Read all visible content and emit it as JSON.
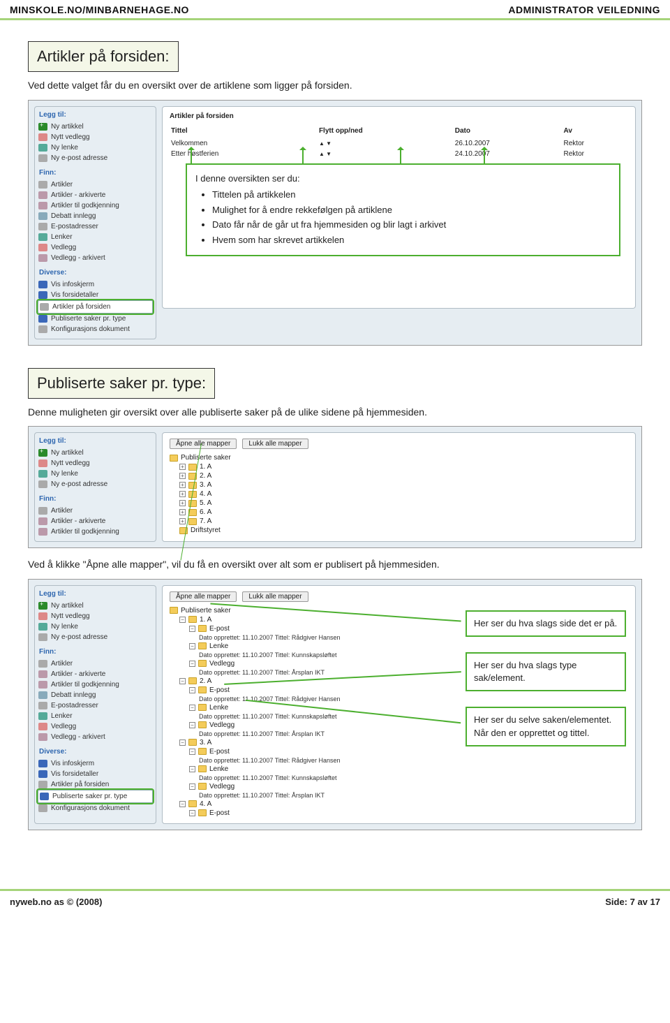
{
  "header": {
    "left": "MINSKOLE.NO/MINBARNEHAGE.NO",
    "right": "ADMINISTRATOR VEILEDNING"
  },
  "sec1": {
    "title": "Artikler på forsiden:",
    "intro": "Ved dette valget får du en oversikt over de artiklene som ligger på forsiden."
  },
  "sidebar1": {
    "legg": "Legg til:",
    "items1": [
      "Ny artikkel",
      "Nytt vedlegg",
      "Ny lenke",
      "Ny e-post adresse"
    ],
    "finn": "Finn:",
    "items2": [
      "Artikler",
      "Artikler - arkiverte",
      "Artikler til godkjenning",
      "Debatt innlegg",
      "E-postadresser",
      "Lenker",
      "Vedlegg",
      "Vedlegg - arkivert"
    ],
    "diverse": "Diverse:",
    "items3": [
      "Vis infoskjerm",
      "Vis forsidetaller",
      "Artikler på forsiden",
      "Publiserte saker pr. type",
      "Konfigurasjons dokument"
    ]
  },
  "tbl1": {
    "heading": "Artikler på forsiden",
    "h1": "Tittel",
    "h2": "Flytt opp/ned",
    "h3": "Dato",
    "h4": "Av",
    "r1c1": "Velkommen",
    "r1c2": "▲ ▼",
    "r1c3": "26.10.2007",
    "r1c4": "Rektor",
    "r2c1": "Etter høstferien",
    "r2c2": "▲ ▼",
    "r2c3": "24.10.2007",
    "r2c4": "Rektor"
  },
  "call1": {
    "lead": "I denne oversikten ser du:",
    "b1": "Tittelen på artikkelen",
    "b2": "Mulighet for å endre rekkefølgen på artiklene",
    "b3": "Dato får når de går ut fra hjemmesiden og blir lagt i arkivet",
    "b4": "Hvem som har skrevet artikkelen"
  },
  "sec2": {
    "title": "Publiserte saker pr. type:",
    "intro": "Denne muligheten gir oversikt over alle publiserte saker på de ulike sidene på hjemmesiden."
  },
  "sidebar2": {
    "items2": [
      "Artikler",
      "Artikler - arkiverte",
      "Artikler til godkjenning"
    ]
  },
  "tree2": {
    "open": "Åpne alle mapper",
    "close": "Lukk alle mapper",
    "root": "Publiserte saker",
    "a1": "1. A",
    "a2": "2. A",
    "a3": "3. A",
    "a4": "4. A",
    "a5": "5. A",
    "a6": "6. A",
    "a7": "7. A",
    "a8": "Driftstyret"
  },
  "sec2b": {
    "text": "Ved å klikke \"Åpne alle mapper\", vil du få en oversikt over alt som er publisert på hjemmesiden."
  },
  "tree3": {
    "ep": "E-post",
    "ln": "Lenke",
    "vd": "Vedlegg",
    "d1": "Dato opprettet: 11.10.2007 Tittel: Rådgiver Hansen",
    "d2": "Dato opprettet: 11.10.2007 Tittel: Kunnskapsløftet",
    "d3": "Dato opprettet: 11.10.2007 Tittel: Årsplan IKT"
  },
  "notes": {
    "n1": "Her ser du hva slags side det er på.",
    "n2": "Her ser du hva slags type sak/element.",
    "n3": "Her ser du selve saken/elementet. Når den er opprettet og tittel."
  },
  "sidebar3": {
    "items2": [
      "Artikler",
      "Artikler - arkiverte",
      "Artikler til godkjenning",
      "Debatt innlegg",
      "E-postadresser",
      "Lenker",
      "Vedlegg",
      "Vedlegg - arkivert"
    ],
    "items3": [
      "Vis infoskjerm",
      "Vis forsidetaller",
      "Artikler på forsiden",
      "Publiserte saker pr. type",
      "Konfigurasjons dokument"
    ]
  },
  "footer": {
    "left": "nyweb.no as © (2008)",
    "right": "Side: 7 av 17"
  }
}
